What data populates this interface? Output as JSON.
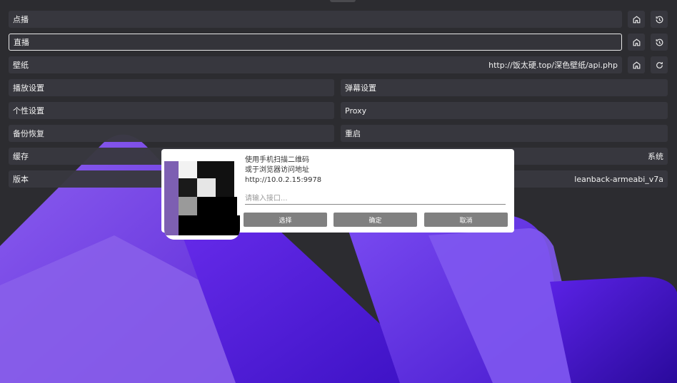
{
  "rows": {
    "vod": {
      "label": "点播"
    },
    "live": {
      "label": "直播"
    },
    "wallpaper": {
      "label": "壁纸",
      "value": "http://饭太硬.top/深色壁纸/api.php"
    },
    "play_settings": {
      "label": "播放设置"
    },
    "danmaku_settings": {
      "label": "弹幕设置"
    },
    "personal_settings": {
      "label": "个性设置"
    },
    "proxy": {
      "label": "Proxy"
    },
    "backup_restore": {
      "label": "备份恢复"
    },
    "restart": {
      "label": "重启"
    },
    "cache": {
      "label": "缓存",
      "value": "系统"
    },
    "version": {
      "label": "版本",
      "value": "leanback-armeabi_v7a"
    }
  },
  "icons": {
    "home": "home-icon",
    "history": "history-icon",
    "refresh": "refresh-icon"
  },
  "dialog": {
    "line1": "使用手机扫描二维码",
    "line2": "或于浏览器访问地址",
    "address": "http://10.0.2.15:9978",
    "input_placeholder": "请输入接口...",
    "input_value": "",
    "btn_select": "选择",
    "btn_confirm": "确定",
    "btn_cancel": "取消"
  },
  "colors": {
    "background": "#2c2c30",
    "row_bg": "#38383e",
    "accent_purple": "#6a2ee6",
    "button_gray": "#808080"
  }
}
